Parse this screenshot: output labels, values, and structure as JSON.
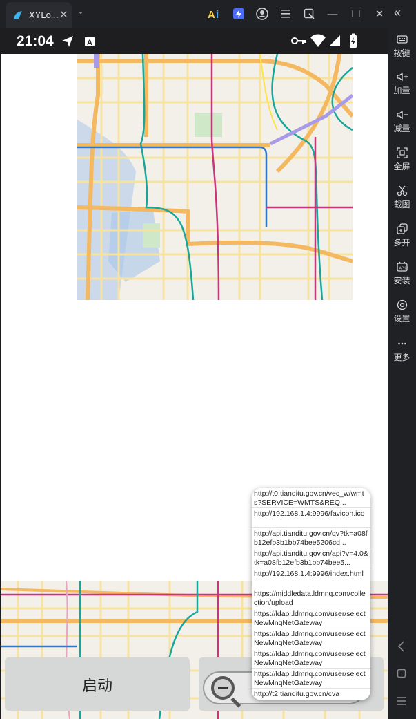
{
  "window": {
    "tab_title": "XYLo...",
    "tab_close": "✕",
    "dropdown": "⌄",
    "controls": {
      "minimize": "—",
      "maximize": "☐",
      "close": "✕"
    }
  },
  "status_bar": {
    "time": "21:04"
  },
  "side_panel": {
    "collapse": "«",
    "items": [
      {
        "label": "按键",
        "icon": "keyboard-icon"
      },
      {
        "label": "加量",
        "icon": "volume-up-icon"
      },
      {
        "label": "减量",
        "icon": "volume-down-icon"
      },
      {
        "label": "全屏",
        "icon": "fullscreen-icon"
      },
      {
        "label": "截图",
        "icon": "scissors-icon"
      },
      {
        "label": "多开",
        "icon": "multi-instance-icon"
      },
      {
        "label": "安装",
        "icon": "install-apk-icon"
      },
      {
        "label": "设置",
        "icon": "settings-icon"
      },
      {
        "label": "更多",
        "icon": "more-icon"
      }
    ]
  },
  "app": {
    "start_button": "启动",
    "url_list": [
      "http://t0.tianditu.gov.cn/vec_w/wmts?SERVICE=WMTS&REQ...",
      "http://192.168.1.4:9996/favicon.ico",
      "http://api.tianditu.gov.cn/qv?tk=a08fb12efb3b1bb74bee5206cd...",
      "http://api.tianditu.gov.cn/api?v=4.0&tk=a08fb12efb3b1bb74bee5...",
      "http://192.168.1.4:9996/index.html",
      "https://middledata.ldmnq.com/collection/upload",
      "https://ldapi.ldmnq.com/user/selectNewMnqNetGateway",
      "https://ldapi.ldmnq.com/user/selectNewMnqNetGateway",
      "https://ldapi.ldmnq.com/user/selectNewMnqNetGateway",
      "https://ldapi.ldmnq.com/user/selectNewMnqNetGateway",
      "http://t2.tianditu.gov.cn/cva"
    ]
  },
  "colors": {
    "road_major": "#f4b860",
    "road_minor": "#f7e3a0",
    "metro_teal": "#1aa59a",
    "metro_magenta": "#c8357a",
    "metro_blue": "#2e78c8",
    "water": "#a9c6ea",
    "park": "#cfe8c8"
  }
}
